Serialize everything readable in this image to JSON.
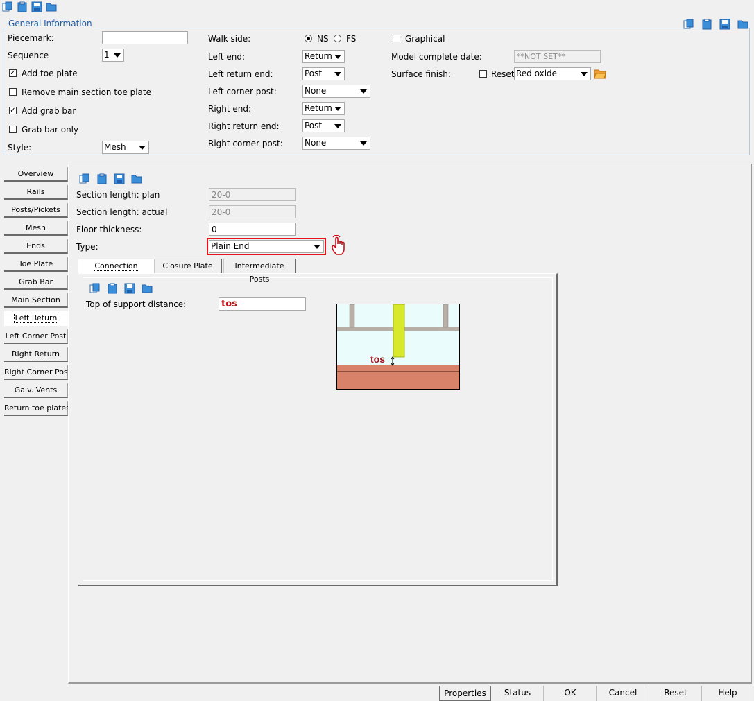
{
  "general": {
    "legend": "General Information",
    "piecemark_label": "Piecemark:",
    "piecemark_value": "",
    "sequence_label": "Sequence",
    "sequence_value": "1",
    "add_toe_plate": "Add toe plate",
    "remove_main_toe_plate": "Remove main section toe plate",
    "add_grab_bar": "Add grab bar",
    "grab_bar_only": "Grab bar only",
    "style_label": "Style:",
    "style_value": "Mesh",
    "walk_side_label": "Walk side:",
    "walk_ns": "NS",
    "walk_fs": "FS",
    "left_end_label": "Left end:",
    "left_end_value": "Return",
    "left_return_end_label": "Left return end:",
    "left_return_end_value": "Post",
    "left_corner_post_label": "Left corner post:",
    "left_corner_post_value": "None",
    "right_end_label": "Right end:",
    "right_end_value": "Return",
    "right_return_end_label": "Right return end:",
    "right_return_end_value": "Post",
    "right_corner_post_label": "Right corner post:",
    "right_corner_post_value": "None",
    "graphical_label": "Graphical",
    "model_complete_label": "Model complete date:",
    "model_complete_value": "**NOT SET**",
    "surface_finish_label": "Surface finish:",
    "reset_label": "Reset",
    "surface_finish_value": "Red oxide"
  },
  "left_tabs": [
    "Overview",
    "Rails",
    "Posts/Pickets",
    "Mesh",
    "Ends",
    "Toe Plate",
    "Grab Bar",
    "Main Section",
    "Left Return",
    "Left Corner Post",
    "Right Return",
    "Right Corner Post",
    "Galv. Vents",
    "Return toe plates"
  ],
  "main": {
    "section_length_plan_label": "Section length: plan",
    "section_length_plan_value": "20-0",
    "section_length_actual_label": "Section length: actual",
    "section_length_actual_value": "20-0",
    "floor_thickness_label": "Floor thickness:",
    "floor_thickness_value": "0",
    "type_label": "Type:",
    "type_value": "Plain End",
    "sub_tabs": [
      "Connection",
      "Closure Plate",
      "Intermediate Posts"
    ],
    "tos_label": "Top of support distance:",
    "tos_value": "tos",
    "diagram_label": "tos"
  },
  "buttons": [
    "Properties",
    "Status",
    "OK",
    "Cancel",
    "Reset",
    "Help"
  ],
  "colors": {
    "accent": "#1f5fa8",
    "highlight": "#e8121a",
    "post": "#d8e82a",
    "floor": "#d9826a"
  }
}
